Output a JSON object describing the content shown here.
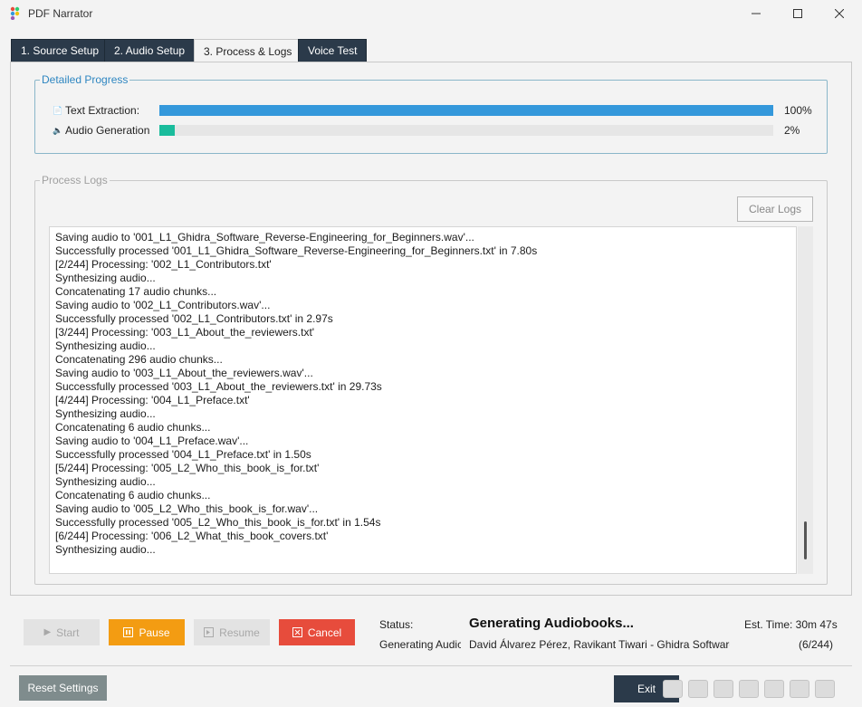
{
  "window": {
    "title": "PDF Narrator"
  },
  "tabs": [
    {
      "label": "1. Source Setup"
    },
    {
      "label": "2. Audio Setup"
    },
    {
      "label": "3. Process & Logs"
    },
    {
      "label": "Voice Test"
    }
  ],
  "progress": {
    "legend": "Detailed Progress",
    "text_extraction": {
      "label": "Text Extraction:",
      "percent_label": "100%",
      "percent": 100,
      "color": "#3498db"
    },
    "audio_generation": {
      "label": "Audio Generation",
      "percent_label": "2%",
      "percent": 2,
      "color": "#1abc9c"
    }
  },
  "logs": {
    "legend": "Process Logs",
    "clear_label": "Clear Logs",
    "lines": [
      "Saving audio to '001_L1_Ghidra_Software_Reverse-Engineering_for_Beginners.wav'...",
      "Successfully processed '001_L1_Ghidra_Software_Reverse-Engineering_for_Beginners.txt' in 7.80s",
      "[2/244] Processing: '002_L1_Contributors.txt'",
      "Synthesizing audio...",
      "Concatenating 17 audio chunks...",
      "Saving audio to '002_L1_Contributors.wav'...",
      "Successfully processed '002_L1_Contributors.txt' in 2.97s",
      "[3/244] Processing: '003_L1_About_the_reviewers.txt'",
      "Synthesizing audio...",
      "Concatenating 296 audio chunks...",
      "Saving audio to '003_L1_About_the_reviewers.wav'...",
      "Successfully processed '003_L1_About_the_reviewers.txt' in 29.73s",
      "[4/244] Processing: '004_L1_Preface.txt'",
      "Synthesizing audio...",
      "Concatenating 6 audio chunks...",
      "Saving audio to '004_L1_Preface.wav'...",
      "Successfully processed '004_L1_Preface.txt' in 1.50s",
      "[5/244] Processing: '005_L2_Who_this_book_is_for.txt'",
      "Synthesizing audio...",
      "Concatenating 6 audio chunks...",
      "Saving audio to '005_L2_Who_this_book_is_for.wav'...",
      "Successfully processed '005_L2_Who_this_book_is_for.txt' in 1.54s",
      "[6/244] Processing: '006_L2_What_this_book_covers.txt'",
      "Synthesizing audio..."
    ]
  },
  "controls": {
    "start": "Start",
    "pause": "Pause",
    "resume": "Resume",
    "cancel": "Cancel"
  },
  "status": {
    "key": "Status:",
    "main": "Generating Audiobooks...",
    "est_time": "Est. Time: 30m 47s",
    "sub_left": "Generating Audic",
    "sub_book": "David Álvarez Pérez, Ravikant Tiwari - Ghidra Software F",
    "count": "(6/244)"
  },
  "footer": {
    "reset": "Reset Settings",
    "exit": "Exit"
  }
}
